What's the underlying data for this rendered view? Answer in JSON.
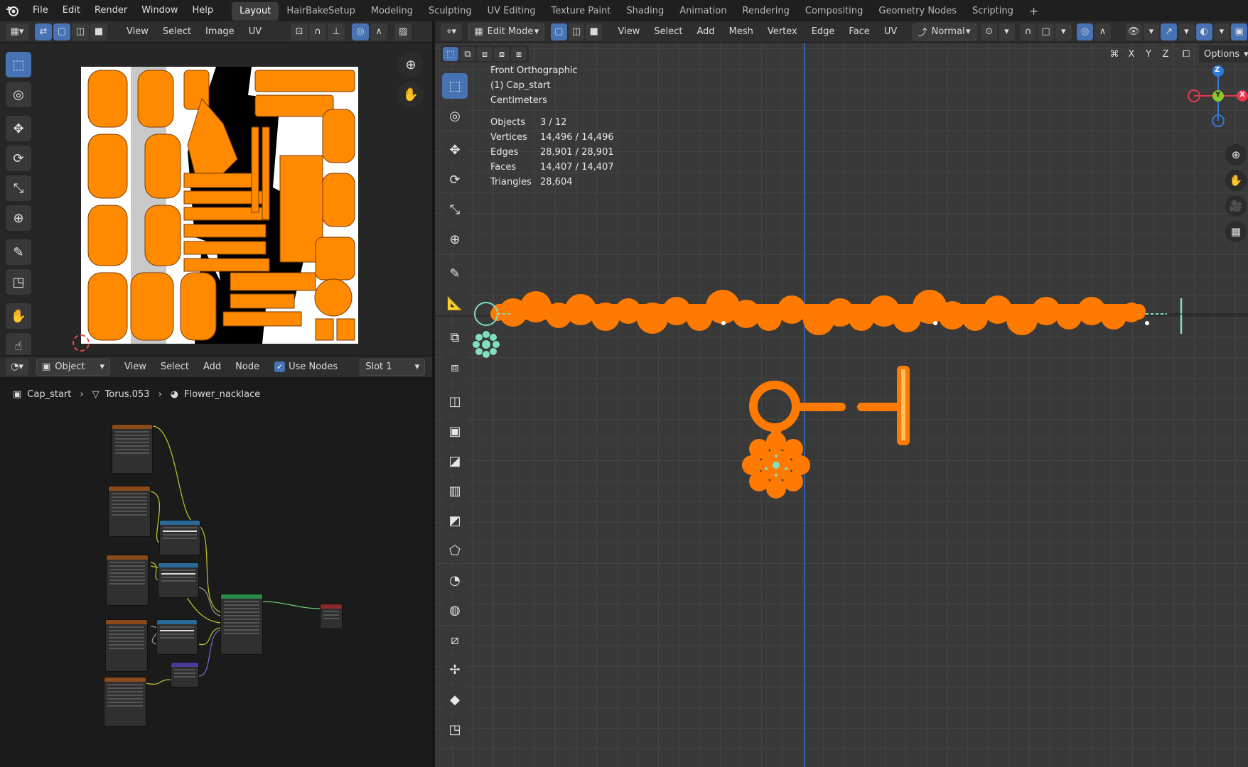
{
  "topbar": {
    "menus": [
      "File",
      "Edit",
      "Render",
      "Window",
      "Help"
    ],
    "workspaces": [
      "Layout",
      "HairBakeSetup",
      "Modeling",
      "Sculpting",
      "UV Editing",
      "Texture Paint",
      "Shading",
      "Animation",
      "Rendering",
      "Compositing",
      "Geometry Nodes",
      "Scripting"
    ],
    "active_workspace": "Layout",
    "add_tab": "+"
  },
  "uv_editor": {
    "menus": [
      "View",
      "Select",
      "Image",
      "UV"
    ]
  },
  "node_editor": {
    "mode": "Object",
    "menus": [
      "View",
      "Select",
      "Add",
      "Node"
    ],
    "use_nodes_label": "Use Nodes",
    "use_nodes_checked": true,
    "slot": "Slot 1",
    "breadcrumb": [
      "Cap_start",
      "Torus.053",
      "Flower_nacklace"
    ]
  },
  "viewport": {
    "mode": "Edit Mode",
    "menus": [
      "View",
      "Select",
      "Add",
      "Mesh",
      "Vertex",
      "Edge",
      "Face",
      "UV"
    ],
    "orientation": "Normal",
    "axes": [
      "X",
      "Y",
      "Z"
    ],
    "options_label": "Options",
    "overlay_text": [
      "Front Orthographic",
      "(1) Cap_start",
      "Centimeters"
    ],
    "stats": [
      {
        "label": "Objects",
        "value": "3 / 12"
      },
      {
        "label": "Vertices",
        "value": "14,496 / 14,496"
      },
      {
        "label": "Edges",
        "value": "28,901 / 28,901"
      },
      {
        "label": "Faces",
        "value": "14,407 / 14,407"
      },
      {
        "label": "Triangles",
        "value": "28,604"
      }
    ],
    "gizmo": {
      "z": "Z",
      "y": "Y",
      "x": "X"
    }
  },
  "colors": {
    "accent": "#4772b3",
    "mesh_orange": "#ff7a00",
    "axis_x": "#e8374f",
    "axis_y": "#8bc72a",
    "axis_z": "#2f7bd9",
    "selected_green": "#7fe0c0"
  }
}
